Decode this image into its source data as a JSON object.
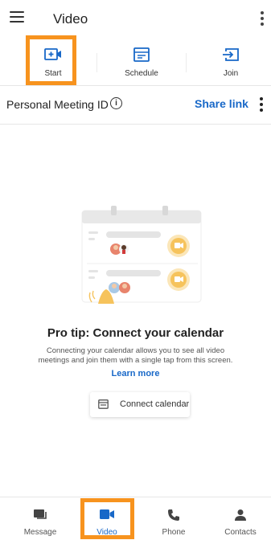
{
  "header": {
    "title": "Video"
  },
  "actions": [
    {
      "label": "Start"
    },
    {
      "label": "Schedule"
    },
    {
      "label": "Join"
    }
  ],
  "pmi": {
    "label": "Personal Meeting ID",
    "share": "Share link"
  },
  "empty_state": {
    "title": "Pro tip: Connect your calendar",
    "description": "Connecting your calendar allows you to see all video meetings and join them with a single tap from this screen.",
    "learn_more": "Learn more",
    "connect_button": "Connect calendar"
  },
  "nav": [
    {
      "label": "Message"
    },
    {
      "label": "Video"
    },
    {
      "label": "Phone"
    },
    {
      "label": "Contacts"
    }
  ],
  "colors": {
    "accent": "#1868c8",
    "highlight": "#f7931e",
    "illustration_orange": "#f6c35c"
  }
}
